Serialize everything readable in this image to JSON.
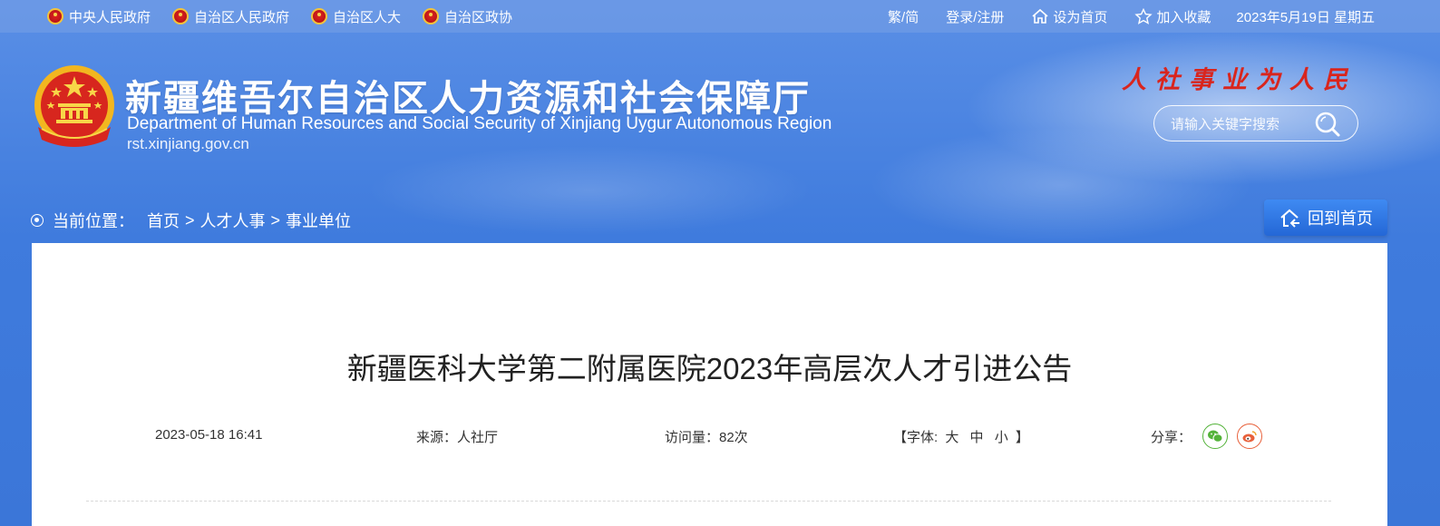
{
  "topbar": {
    "links": [
      {
        "label": "中央人民政府"
      },
      {
        "label": "自治区人民政府"
      },
      {
        "label": "自治区人大"
      },
      {
        "label": "自治区政协"
      }
    ],
    "lang_toggle": "繁/简",
    "login": "登录/注册",
    "set_home": "设为首页",
    "add_favorite": "加入收藏",
    "date": "2023年5月19日 星期五"
  },
  "header": {
    "title_cn": "新疆维吾尔自治区人力资源和社会保障厅",
    "title_en": "Department of Human Resources and Social Security of Xinjiang Uygur Autonomous Region",
    "domain": "rst.xinjiang.gov.cn",
    "slogan": "人社事业为人民",
    "search": {
      "placeholder": "请输入关键字搜索"
    }
  },
  "breadcrumb": {
    "label": "当前位置：",
    "items": [
      "首页",
      "人才人事",
      "事业单位"
    ],
    "separator": ">"
  },
  "home_button": {
    "label": "回到首页"
  },
  "article": {
    "title": "新疆医科大学第二附属医院2023年高层次人才引进公告",
    "date": "2023-05-18 16:41",
    "source": "来源：人社厅",
    "views": "访问量：82次",
    "font_label": "【字体:",
    "font_sizes": [
      "大",
      "中",
      "小"
    ],
    "font_close": "】",
    "share_label": "分享："
  },
  "colors": {
    "background_blue": "#3d78d8",
    "slogan_red": "#d9251d",
    "button_blue": "#2467d6",
    "wechat_green": "#54b33a",
    "weibo_orange": "#e8603a"
  }
}
